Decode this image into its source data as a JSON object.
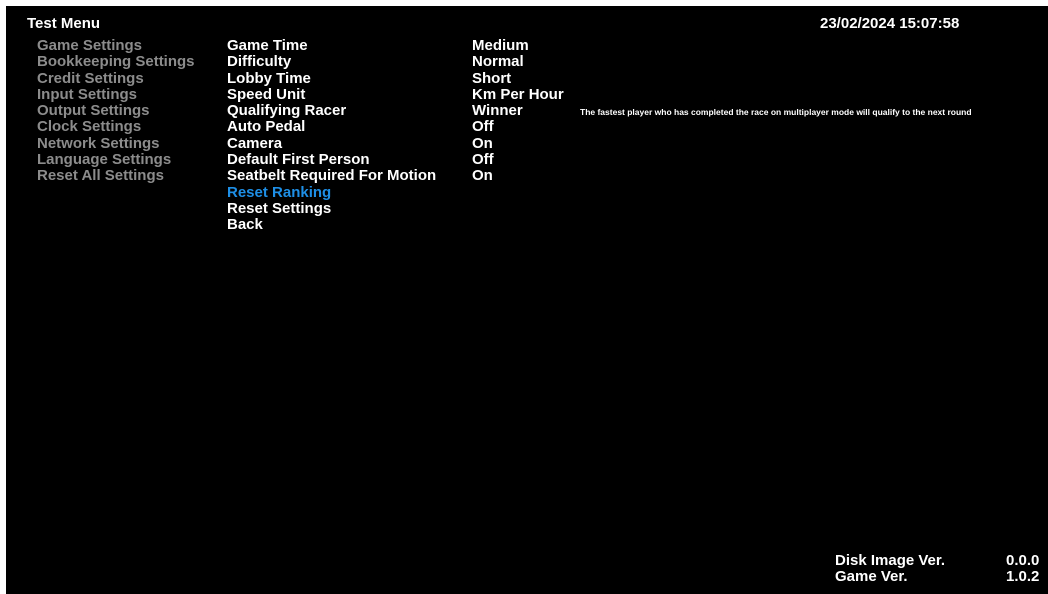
{
  "header": {
    "title": "Test Menu",
    "datetime": "23/02/2024 15:07:58"
  },
  "categories": [
    "Game Settings",
    "Bookkeeping Settings",
    "Credit Settings",
    "Input Settings",
    "Output Settings",
    "Clock Settings",
    "Network Settings",
    "Language Settings",
    "Reset All Settings"
  ],
  "options": [
    {
      "label": "Game Time",
      "value": "Medium"
    },
    {
      "label": "Difficulty",
      "value": "Normal"
    },
    {
      "label": "Lobby Time",
      "value": "Short"
    },
    {
      "label": "Speed Unit",
      "value": "Km Per Hour"
    },
    {
      "label": "Qualifying Racer",
      "value": "Winner"
    },
    {
      "label": "Auto Pedal",
      "value": "Off"
    },
    {
      "label": "Camera",
      "value": "On"
    },
    {
      "label": "Default First Person",
      "value": "Off"
    },
    {
      "label": "Seatbelt Required For Motion",
      "value": "On"
    },
    {
      "label": "Reset Ranking"
    },
    {
      "label": "Reset Settings"
    },
    {
      "label": "Back"
    }
  ],
  "selected_option": "Reset Ranking",
  "description": "The fastest player who has completed the race on multiplayer mode will qualify to the next round",
  "version": {
    "disk_image_label": "Disk Image Ver.",
    "disk_image_value": "0.0.0",
    "game_label": "Game Ver.",
    "game_value": "1.0.2"
  },
  "colors": {
    "background": "#000000",
    "text": "#ffffff",
    "inactive_category": "#8c8c8c",
    "selected": "#1e8fe6"
  }
}
